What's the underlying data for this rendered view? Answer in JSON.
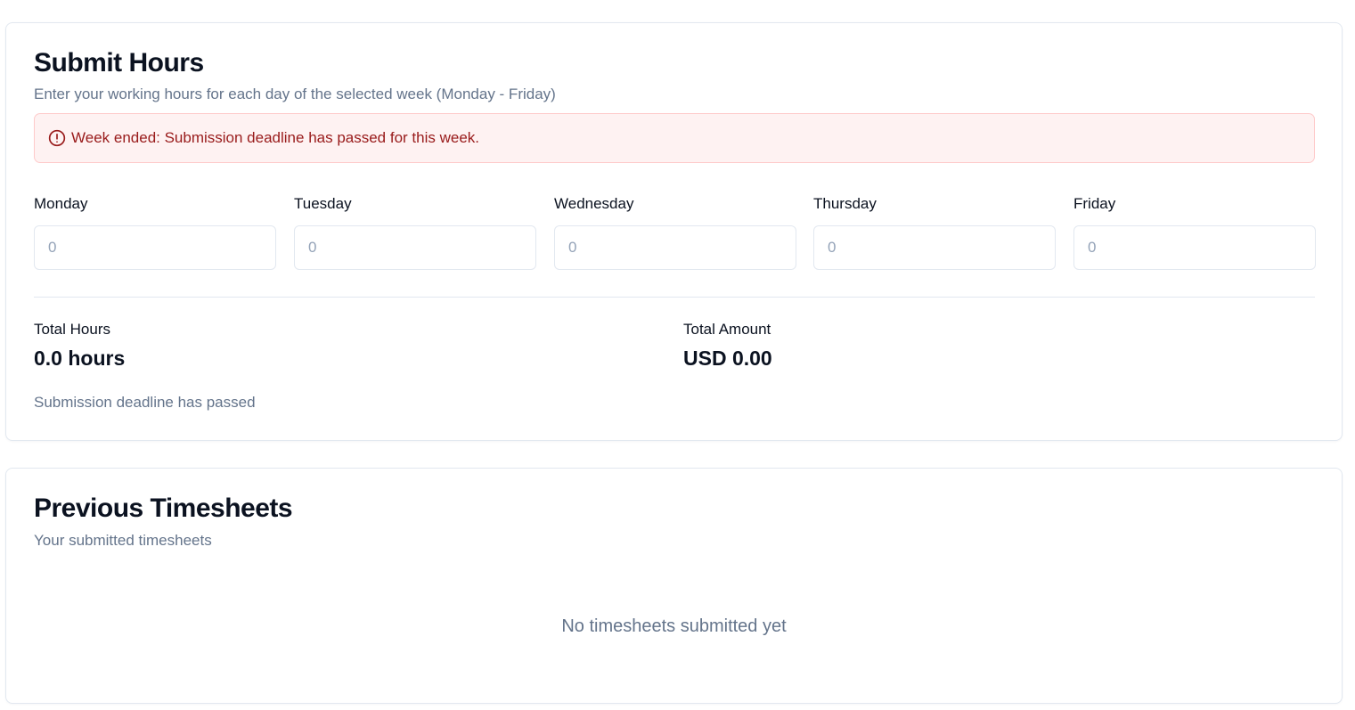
{
  "submit": {
    "title": "Submit Hours",
    "description": "Enter your working hours for each day of the selected week (Monday - Friday)",
    "alert": {
      "icon": "alert-circle-icon",
      "text": "Week ended: Submission deadline has passed for this week."
    },
    "days": [
      {
        "label": "Monday",
        "placeholder": "0",
        "value": ""
      },
      {
        "label": "Tuesday",
        "placeholder": "0",
        "value": ""
      },
      {
        "label": "Wednesday",
        "placeholder": "0",
        "value": ""
      },
      {
        "label": "Thursday",
        "placeholder": "0",
        "value": ""
      },
      {
        "label": "Friday",
        "placeholder": "0",
        "value": ""
      }
    ],
    "total_hours": {
      "label": "Total Hours",
      "value": "0.0 hours"
    },
    "total_amount": {
      "label": "Total Amount",
      "value": "USD 0.00"
    },
    "deadline_note": "Submission deadline has passed"
  },
  "previous": {
    "title": "Previous Timesheets",
    "description": "Your submitted timesheets",
    "empty_message": "No timesheets submitted yet"
  },
  "colors": {
    "alert_bg": "#fef2f2",
    "alert_border": "#fecaca",
    "alert_text": "#991b1b",
    "muted_text": "#64748b",
    "border": "#e2e8f0"
  }
}
